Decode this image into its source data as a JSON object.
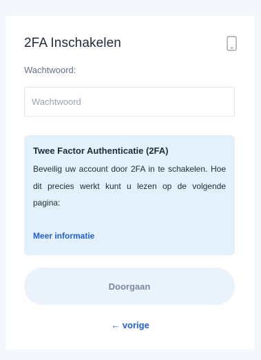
{
  "card": {
    "title": "2FA Inschakelen",
    "device_icon": "smartphone-icon"
  },
  "password": {
    "label": "Wachtwoord:",
    "placeholder": "Wachtwoord",
    "value": ""
  },
  "info": {
    "title": "Twee Factor Authenticatie (2FA)",
    "text": "Beveilig uw account door 2FA in te schakelen. Hoe dit precies werkt kunt u lezen op de volgende pagina:",
    "link_label": "Meer informatie"
  },
  "actions": {
    "continue_label": "Doorgaan",
    "back_label": "← vorige"
  },
  "colors": {
    "accent": "#1f5fd6",
    "info_background": "#e3f1fd",
    "button_background": "#eaf3fc",
    "page_background": "#f3f7fc"
  }
}
